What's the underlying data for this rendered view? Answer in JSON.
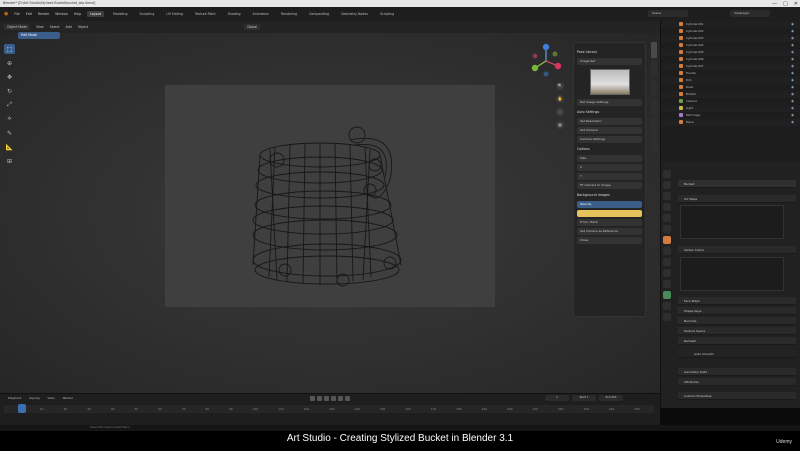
{
  "window": {
    "title": "Blender* [D:\\Art Studio\\Stylized Bucket\\bucket_wip.blend]",
    "controls": [
      "—",
      "□",
      "✕"
    ]
  },
  "topbar": {
    "menus": [
      "File",
      "Edit",
      "Render",
      "Window",
      "Help"
    ],
    "workspaces": [
      "Layout",
      "Modeling",
      "Sculpting",
      "UV Editing",
      "Texture Paint",
      "Shading",
      "Animation",
      "Rendering",
      "Compositing",
      "Geometry Nodes",
      "Scripting"
    ],
    "active_workspace": "Layout",
    "scene": "Scene",
    "view_layer": "ViewLayer"
  },
  "viewport": {
    "header": [
      "Object Mode",
      "View",
      "Select",
      "Add",
      "Object",
      "Global"
    ],
    "mode_badge": "Edit Mode",
    "tools": [
      {
        "icon": "select-icon",
        "glyph": "⬚"
      },
      {
        "icon": "cursor-icon",
        "glyph": "⊕"
      },
      {
        "icon": "move-icon",
        "glyph": "✥"
      },
      {
        "icon": "rotate-icon",
        "glyph": "↻"
      },
      {
        "icon": "scale-icon",
        "glyph": "⤢"
      },
      {
        "icon": "transform-icon",
        "glyph": "⟡"
      },
      {
        "icon": "annotate-icon",
        "glyph": "✎"
      },
      {
        "icon": "measure-icon",
        "glyph": "📐"
      },
      {
        "icon": "add-cube-icon",
        "glyph": "⊞"
      }
    ],
    "nav_buttons": [
      "🔍",
      "✋",
      "🎥",
      "▦"
    ]
  },
  "npanel": {
    "title": "Pose Library",
    "rows": [
      {
        "label": "Image Ref",
        "style": "normal"
      },
      {
        "label": "",
        "style": "thumb"
      },
      {
        "label": "Ref Image Settings",
        "style": "normal"
      },
      {
        "label": "Auto Settings",
        "style": "head"
      },
      {
        "label": "Set Resolution",
        "style": "normal"
      },
      {
        "label": "Set Camera",
        "style": "normal"
      },
      {
        "label": "Camera Settings",
        "style": "normal"
      },
      {
        "label": "Options",
        "style": "head"
      },
      {
        "label": "Size",
        "style": "normal"
      },
      {
        "label": "X",
        "style": "normal"
      },
      {
        "label": "Y",
        "style": "normal"
      },
      {
        "label": "Fit Camera to Image",
        "style": "normal"
      },
      {
        "label": "Background Images",
        "style": "head"
      },
      {
        "label": "Opacity",
        "style": "blue"
      },
      {
        "label": "",
        "style": "yellow"
      },
      {
        "label": "Front / Back",
        "style": "normal"
      },
      {
        "label": "Set Camera as Reference",
        "style": "normal"
      },
      {
        "label": "Close",
        "style": "normal"
      }
    ]
  },
  "outliner": {
    "rows": [
      "Cylinder.001",
      "Cylinder.002",
      "Cylinder.003",
      "Cylinder.004",
      "Cylinder.005",
      "Cylinder.006",
      "Cylinder.007",
      "Handle",
      "Rim",
      "Rivet",
      "Bottom",
      "Camera",
      "Light",
      "Ref Image",
      "Plane"
    ]
  },
  "properties": {
    "object_name": "Bucket",
    "sections": [
      "UV Maps",
      "Vertex Colors",
      "Face Maps",
      "Shape Keys",
      "Normals",
      "Texture Space",
      "Remesh",
      "Geometry Data",
      "Attributes",
      "Custom Properties"
    ],
    "sub_label": "Auto Smooth"
  },
  "timeline": {
    "menus": [
      "Playback",
      "Keying",
      "View",
      "Marker"
    ],
    "ticks": [
      "0",
      "10",
      "20",
      "30",
      "40",
      "50",
      "60",
      "70",
      "80",
      "90",
      "100",
      "110",
      "120",
      "130",
      "140",
      "150",
      "160",
      "170",
      "180",
      "190",
      "200",
      "210",
      "220",
      "230",
      "240",
      "250"
    ],
    "current_frame": "1",
    "start": "Start 1",
    "end": "End 250"
  },
  "statusbar": {
    "text": "Select         Pan View         Context Menu"
  },
  "caption": "Art Studio - Creating Stylized Bucket in Blender 3.1",
  "branding": "Udemy"
}
